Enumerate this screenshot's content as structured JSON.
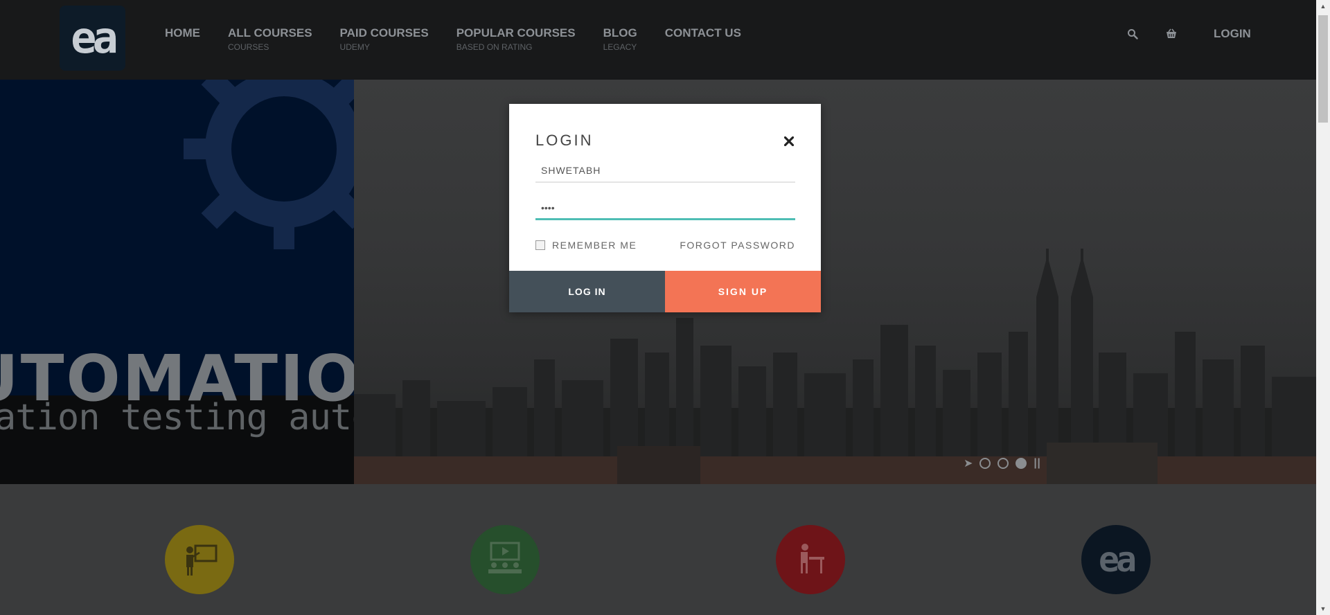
{
  "nav": {
    "logo_text": "ea",
    "items": [
      {
        "label": "HOME",
        "sub": ""
      },
      {
        "label": "ALL COURSES",
        "sub": "COURSES"
      },
      {
        "label": "PAID COURSES",
        "sub": "UDEMY"
      },
      {
        "label": "POPULAR COURSES",
        "sub": "BASED ON RATING"
      },
      {
        "label": "BLOG",
        "sub": "LEGACY"
      },
      {
        "label": "CONTACT US",
        "sub": ""
      }
    ],
    "icons": [
      "search-icon",
      "cart-icon"
    ],
    "login_label": "LOGIN"
  },
  "hero": {
    "title": "UTOMATION",
    "subtitle": "ation testing automated",
    "slider": {
      "count": 3,
      "active": 3
    }
  },
  "features": {
    "icons": [
      "teacher-icon",
      "video-class-icon",
      "student-desk-icon",
      "ea-logo-icon"
    ],
    "colors": [
      "#7a6a12",
      "#264f2c",
      "#6e1418",
      "#0b1622"
    ]
  },
  "modal": {
    "title": "LOGIN",
    "username_value": "SHWETABH",
    "password_value": "••••",
    "remember_label": "REMEMBER ME",
    "remember_checked": false,
    "forgot_label": "FORGOT PASSWORD",
    "login_button": "LOG IN",
    "signup_button": "SIGN UP"
  },
  "colors": {
    "login_button": "#445059",
    "signup_button": "#f37455",
    "focus_underline": "#4ebdb4"
  }
}
